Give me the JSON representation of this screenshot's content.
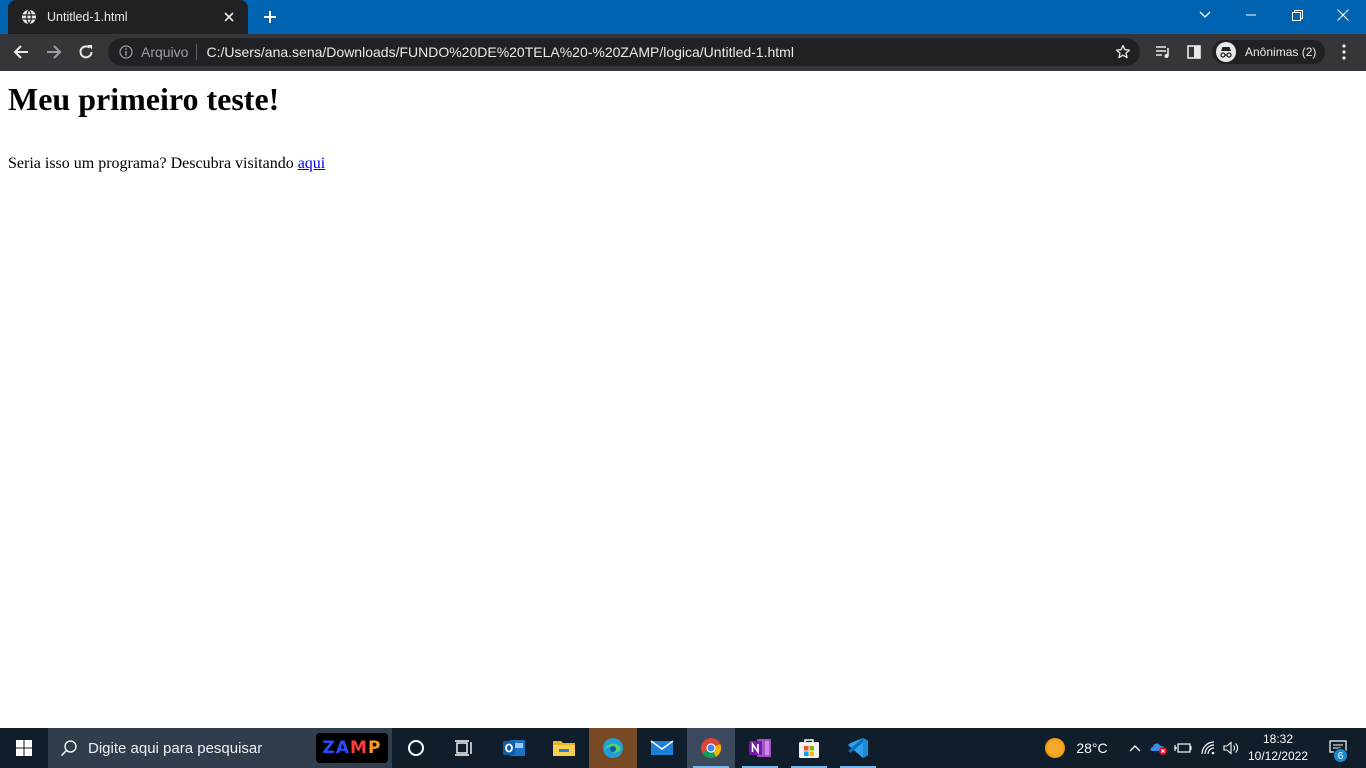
{
  "browser": {
    "tab": {
      "title": "Untitled-1.html",
      "favicon": "globe-icon",
      "close_icon": "close-icon"
    },
    "new_tab_icon": "plus-icon",
    "window_controls": [
      "tab-search-icon",
      "minimize-icon",
      "restore-icon",
      "close-icon"
    ],
    "nav": [
      "back-icon",
      "forward-icon",
      "reload-icon"
    ],
    "omnibox": {
      "security_chip": "Arquivo",
      "url": "C:/Users/ana.sena/Downloads/FUNDO%20DE%20TELA%20-%20ZAMP/logica/Untitled-1.html",
      "bookmark_icon": "star-icon"
    },
    "toolbar_icons": [
      "media-queue-icon",
      "side-panel-icon",
      "menu-dots-icon"
    ],
    "profile": {
      "label": "Anônimas (2)",
      "icon": "incognito-icon"
    },
    "colors": {
      "frame": "#0063b1",
      "tab": "#202124",
      "toolbar": "#35363a"
    }
  },
  "page": {
    "heading": "Meu primeiro teste!",
    "paragraph_text": "Seria isso um programa? Descubra visitando ",
    "link_text": "aqui",
    "link_color": "#0000ee"
  },
  "taskbar": {
    "search_placeholder": "Digite aqui para pesquisar",
    "pinned_logo": "ZAMP",
    "apps": [
      "cortana-icon",
      "task-view-icon",
      "outlook-icon",
      "file-explorer-icon",
      "edge-icon",
      "mail-icon",
      "chrome-icon",
      "onenote-icon",
      "store-icon",
      "vscode-icon"
    ],
    "weather": {
      "temperature": "28°C",
      "icon": "sun-icon"
    },
    "clock": {
      "time": "18:32",
      "date": "10/12/2022"
    },
    "notifications_count": "6",
    "colors": {
      "background": "#101d2b",
      "search": "#2f3d4c"
    }
  }
}
